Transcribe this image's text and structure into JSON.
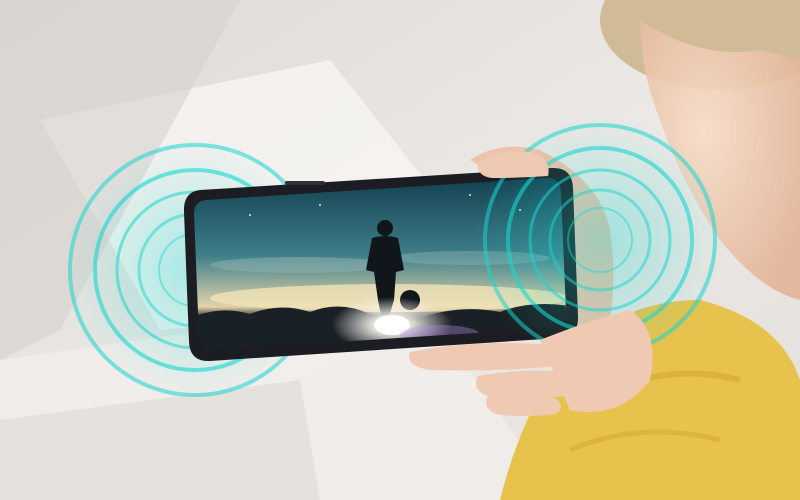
{
  "scene": {
    "background": "#e9e6e3",
    "light_beam": "#f6f4f1",
    "shadow": "#d2ceca",
    "hair_color": "#cdb38a",
    "skin_color": "#f0c9b2",
    "sweater_color": "#e7c24d",
    "phone_frame": "#1b1d22",
    "sound_wave_color": "#18d6d0",
    "screen_sky_top": "#0f3a4a",
    "screen_sky_mid": "#3e7f8a",
    "screen_horizon": "#e2d3a8",
    "screen_ground": "#1a2126",
    "silhouette_color": "#11161b",
    "flare_color": "#ffffff"
  }
}
